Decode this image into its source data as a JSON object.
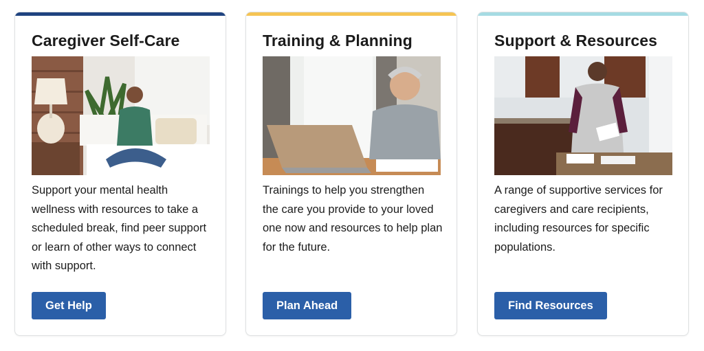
{
  "colors": {
    "accent_navy": "#1f4380",
    "accent_gold": "#f5c454",
    "accent_teal": "#a6dbe3",
    "button_blue": "#2b5fa8"
  },
  "cards": [
    {
      "title": "Caregiver Self-Care",
      "image_icon": "woman-meditating-photo",
      "description": "Support your mental health wellness with resources to take a scheduled break, find peer support or learn of other ways to connect with support.",
      "button_label": "Get Help"
    },
    {
      "title": "Training & Planning",
      "image_icon": "man-on-laptop-photo",
      "description": "Trainings to help you strengthen the care you provide to your loved one now and resources to help plan for the future.",
      "button_label": "Plan Ahead"
    },
    {
      "title": "Support & Resources",
      "image_icon": "man-on-phone-kitchen-photo",
      "description": "A range of supportive services for caregivers and care recipients, including resources for specific populations.",
      "button_label": "Find Resources"
    }
  ]
}
